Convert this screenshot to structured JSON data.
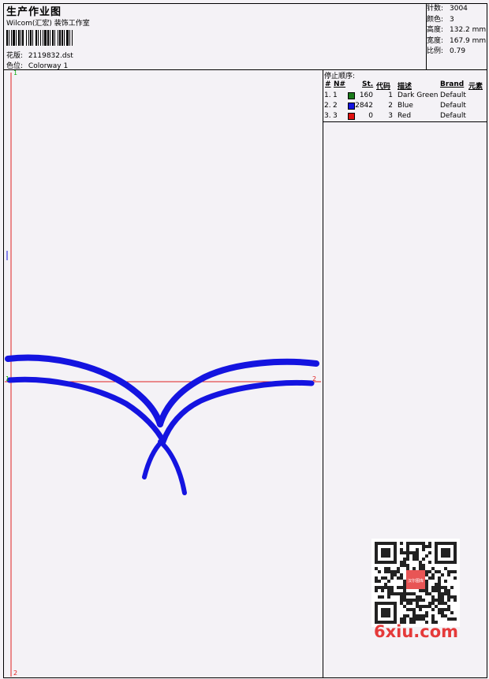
{
  "header": {
    "title": "生产作业图",
    "company": "Wilcom(汇宏) 装饰工作室",
    "design_label": "花版:",
    "design_value": "2119832.dst",
    "colorway_label": "色位:",
    "colorway_value": "Colorway 1"
  },
  "stats": [
    {
      "label": "针数:",
      "value": "3004"
    },
    {
      "label": "颜色:",
      "value": "3"
    },
    {
      "label": "高度:",
      "value": "132.2 mm"
    },
    {
      "label": "宽度:",
      "value": "167.9 mm"
    },
    {
      "label": "比例:",
      "value": "0.79"
    }
  ],
  "stop_sequence": {
    "heading": "停止顺序:",
    "columns": [
      "#",
      "N#",
      "St.",
      "代码",
      "描述",
      "Brand",
      "元素"
    ],
    "rows": [
      {
        "num": "1.",
        "n": "1",
        "color": "#1a7a1a",
        "stitches": "160",
        "code": "1",
        "desc": "Dark Green",
        "brand": "Default"
      },
      {
        "num": "2.",
        "n": "2",
        "color": "#1414e0",
        "stitches": "2842",
        "code": "2",
        "desc": "Blue",
        "brand": "Default"
      },
      {
        "num": "3.",
        "n": "3",
        "color": "#e01010",
        "stitches": "0",
        "code": "3",
        "desc": "Red",
        "brand": "Default"
      }
    ]
  },
  "markers": {
    "v_top": "1",
    "v_bottom": "2",
    "h_left": "1",
    "h_right": "2"
  },
  "colors": {
    "thread_blue": "#1414e0",
    "guide_red": "#e02020",
    "guide_green": "#11aa11"
  },
  "watermark": {
    "qr_seal": "汉尔图库",
    "text": "6xiu.com"
  }
}
